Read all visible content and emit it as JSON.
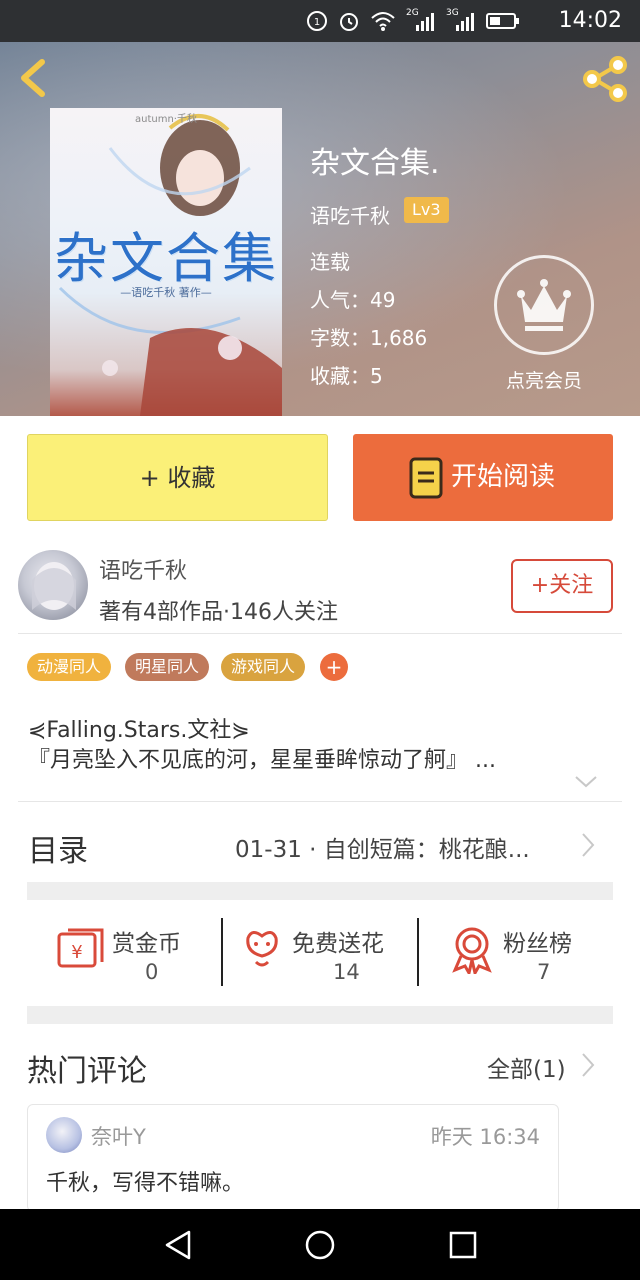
{
  "status_bar": {
    "time": "14:02",
    "network_2g": "2G",
    "network_3g": "3G"
  },
  "hero": {
    "cover": {
      "title": "杂文合集",
      "subtitle": "—语吃千秋 著作—",
      "topline": "autumn·千秋"
    },
    "book_title": "杂文合集.",
    "author": "语吃千秋",
    "level": "Lv3",
    "status": "连载",
    "popularity": "人气：49",
    "words": "字数：1,686",
    "favorites": "收藏：5",
    "vip_label": "点亮会员"
  },
  "actions": {
    "favorite": "+ 收藏",
    "read": "开始阅读"
  },
  "author_row": {
    "name": "语吃千秋",
    "stats": "著有4部作品·146人关注",
    "follow": "+关注"
  },
  "tags": [
    {
      "label": "动漫同人",
      "color": "#f0b23e"
    },
    {
      "label": "明星同人",
      "color": "#c07a5c"
    },
    {
      "label": "游戏同人",
      "color": "#d9a33f"
    }
  ],
  "tag_add": "+",
  "description": {
    "line1": "⋞Falling.Stars.文社⋟",
    "line2": "『月亮坠入不见底的河，星星垂眸惊动了舸』 ..."
  },
  "catalog": {
    "label": "目录",
    "latest": "01-31 · 自创短篇：桃花酿..."
  },
  "stats": [
    {
      "label": "赏金币",
      "value": "0",
      "icon": "reward-coin-icon"
    },
    {
      "label": "免费送花",
      "value": "14",
      "icon": "flower-icon"
    },
    {
      "label": "粉丝榜",
      "value": "7",
      "icon": "fan-rank-icon"
    }
  ],
  "comments": {
    "title": "热门评论",
    "all": "全部(1)",
    "items": [
      {
        "user": "奈叶Y",
        "time": "昨天 16:34",
        "text": "千秋，写得不错嘛。"
      }
    ]
  },
  "colors": {
    "accent": "#ec6c3d",
    "favorite_button": "#fbf078",
    "follow": "#d64a3a",
    "status_bar": "#2e3033"
  }
}
